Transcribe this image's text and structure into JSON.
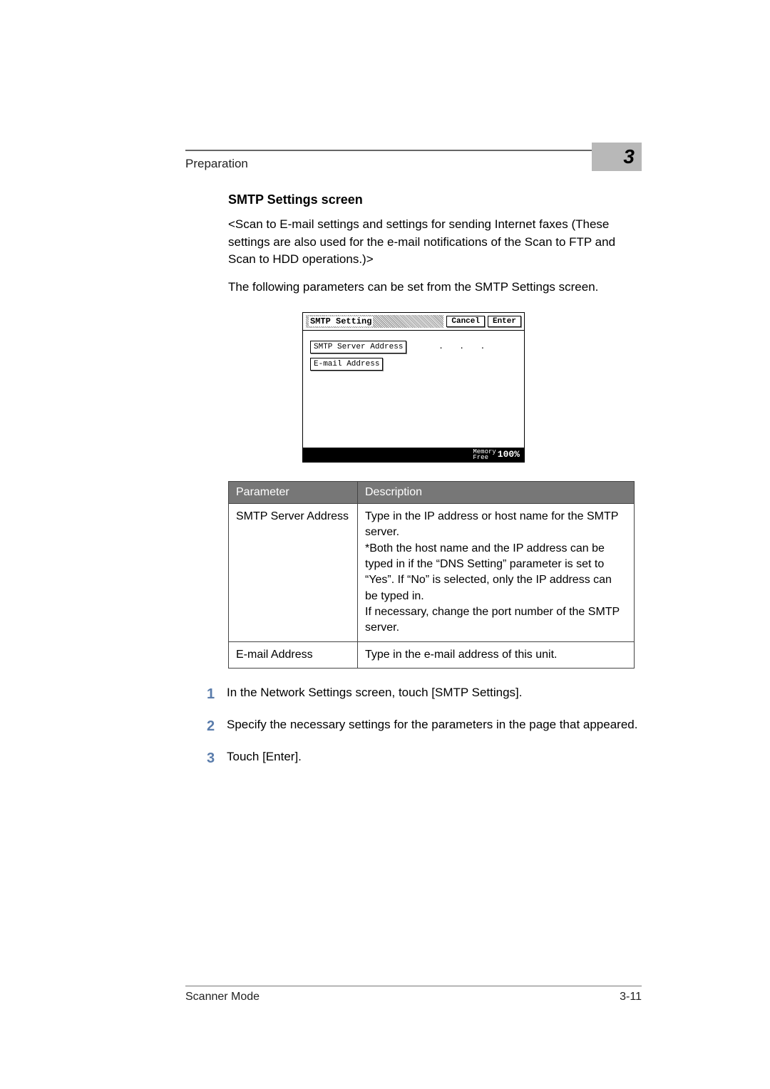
{
  "header": {
    "section": "Preparation",
    "chapter_number": "3"
  },
  "heading": "SMTP Settings screen",
  "intro_para": "<Scan to E-mail settings and settings for sending Internet faxes (These settings are also used for the e-mail notifications of the Scan to FTP and Scan to HDD operations.)>",
  "subpara": "The following parameters can be set from the SMTP Settings screen.",
  "screenshot": {
    "title": "SMTP Setting",
    "cancel": "Cancel",
    "enter": "Enter",
    "fields": [
      {
        "label": "SMTP Server Address",
        "value": ".   .   ."
      },
      {
        "label": "E-mail Address",
        "value": ""
      }
    ],
    "memory_label_top": "Memory",
    "memory_label_bottom": "Free",
    "memory_value": "100%"
  },
  "table": {
    "col1": "Parameter",
    "col2": "Description",
    "rows": [
      {
        "param": "SMTP Server Address",
        "desc": "Type in the IP address or host name for the SMTP server.\n*Both the host name and the IP address can be typed in if the “DNS Setting” parameter is set to “Yes”. If “No” is selected, only the IP address can be typed in.\nIf necessary, change the port number of the SMTP server."
      },
      {
        "param": "E-mail Address",
        "desc": "Type in the e-mail address of this unit."
      }
    ]
  },
  "steps": [
    {
      "n": "1",
      "text": "In the Network Settings screen, touch [SMTP Settings]."
    },
    {
      "n": "2",
      "text": "Specify the necessary settings for the parameters in the page that appeared."
    },
    {
      "n": "3",
      "text": "Touch [Enter]."
    }
  ],
  "footer": {
    "left": "Scanner Mode",
    "right": "3-11"
  }
}
